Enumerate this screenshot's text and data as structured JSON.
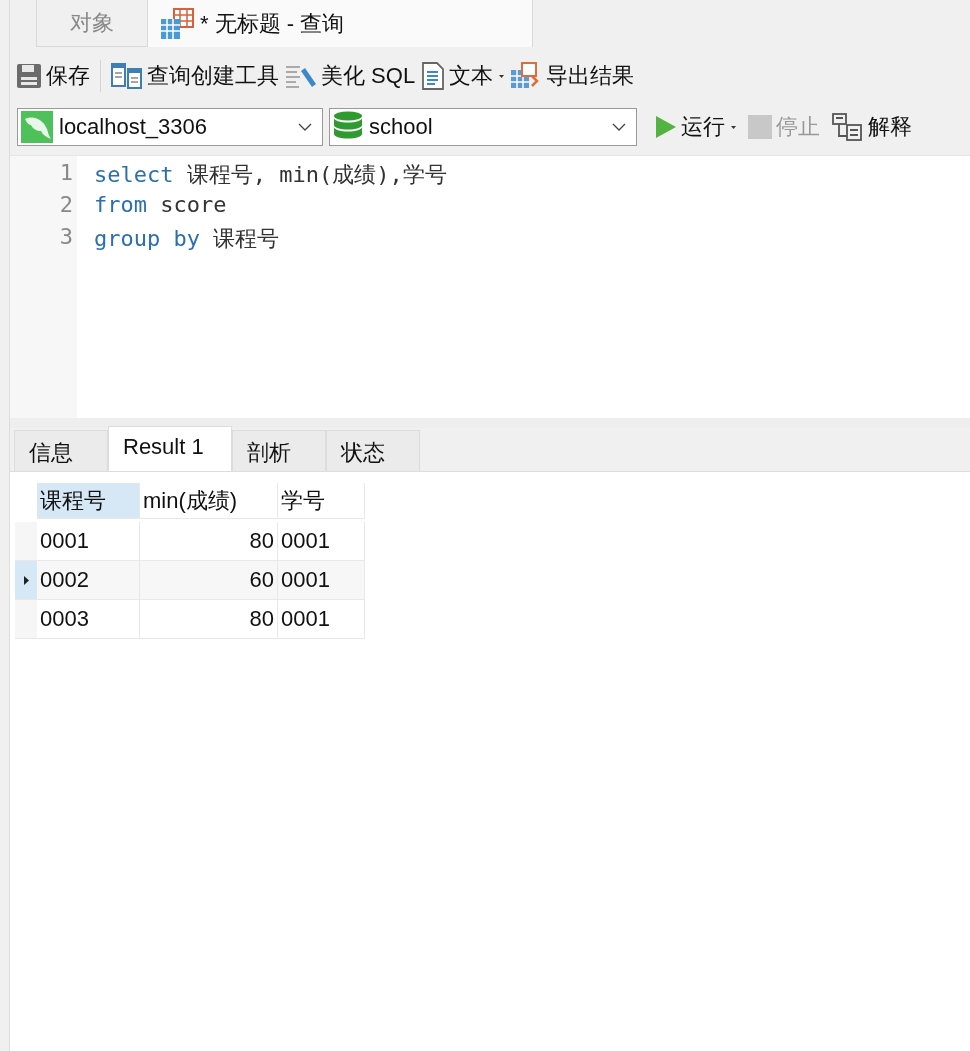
{
  "tabs": [
    {
      "label": "对象",
      "selected": false,
      "icon": false
    },
    {
      "label": "* 无标题 - 查询",
      "selected": true,
      "icon": true
    }
  ],
  "toolbar": [
    {
      "label": "保存",
      "kind": "save"
    },
    {
      "label": "查询创建工具",
      "kind": "builder"
    },
    {
      "label": "美化 SQL",
      "kind": "beautify"
    },
    {
      "label": "文本",
      "kind": "text",
      "dropdown": true
    },
    {
      "label": "导出结果",
      "kind": "export"
    }
  ],
  "connection": {
    "value": "localhost_3306"
  },
  "database": {
    "value": "school"
  },
  "actions": [
    {
      "label": "运行",
      "kind": "run",
      "disabled": false,
      "dropdown": true
    },
    {
      "label": "停止",
      "kind": "stop",
      "disabled": true,
      "dropdown": false
    },
    {
      "label": "解释",
      "kind": "explain",
      "disabled": false,
      "dropdown": false
    }
  ],
  "editor": {
    "lines": [
      {
        "number": "1",
        "tokens": [
          {
            "text": "select",
            "kind": "keyword"
          },
          {
            "text": " 课程号, min(成绩),学号",
            "kind": "plain"
          }
        ]
      },
      {
        "number": "2",
        "tokens": [
          {
            "text": "from",
            "kind": "keyword"
          },
          {
            "text": " score",
            "kind": "plain"
          }
        ]
      },
      {
        "number": "3",
        "tokens": [
          {
            "text": "group by",
            "kind": "keyword"
          },
          {
            "text": " 课程号",
            "kind": "plain"
          }
        ]
      }
    ]
  },
  "result_tabs": [
    {
      "label": "信息",
      "selected": false
    },
    {
      "label": "Result 1",
      "selected": true
    },
    {
      "label": "剖析",
      "selected": false
    },
    {
      "label": "状态",
      "selected": false
    }
  ],
  "table": {
    "columns": [
      {
        "label": "课程号",
        "selected": true,
        "kind": "text"
      },
      {
        "label": "min(成绩)",
        "selected": false,
        "kind": "number"
      },
      {
        "label": "学号",
        "selected": false,
        "kind": "text"
      }
    ],
    "rows": [
      {
        "cells": [
          "0001",
          "80",
          "0001"
        ],
        "selected": false
      },
      {
        "cells": [
          "0002",
          "60",
          "0001"
        ],
        "selected": true
      },
      {
        "cells": [
          "0003",
          "80",
          "0001"
        ],
        "selected": false
      }
    ]
  }
}
